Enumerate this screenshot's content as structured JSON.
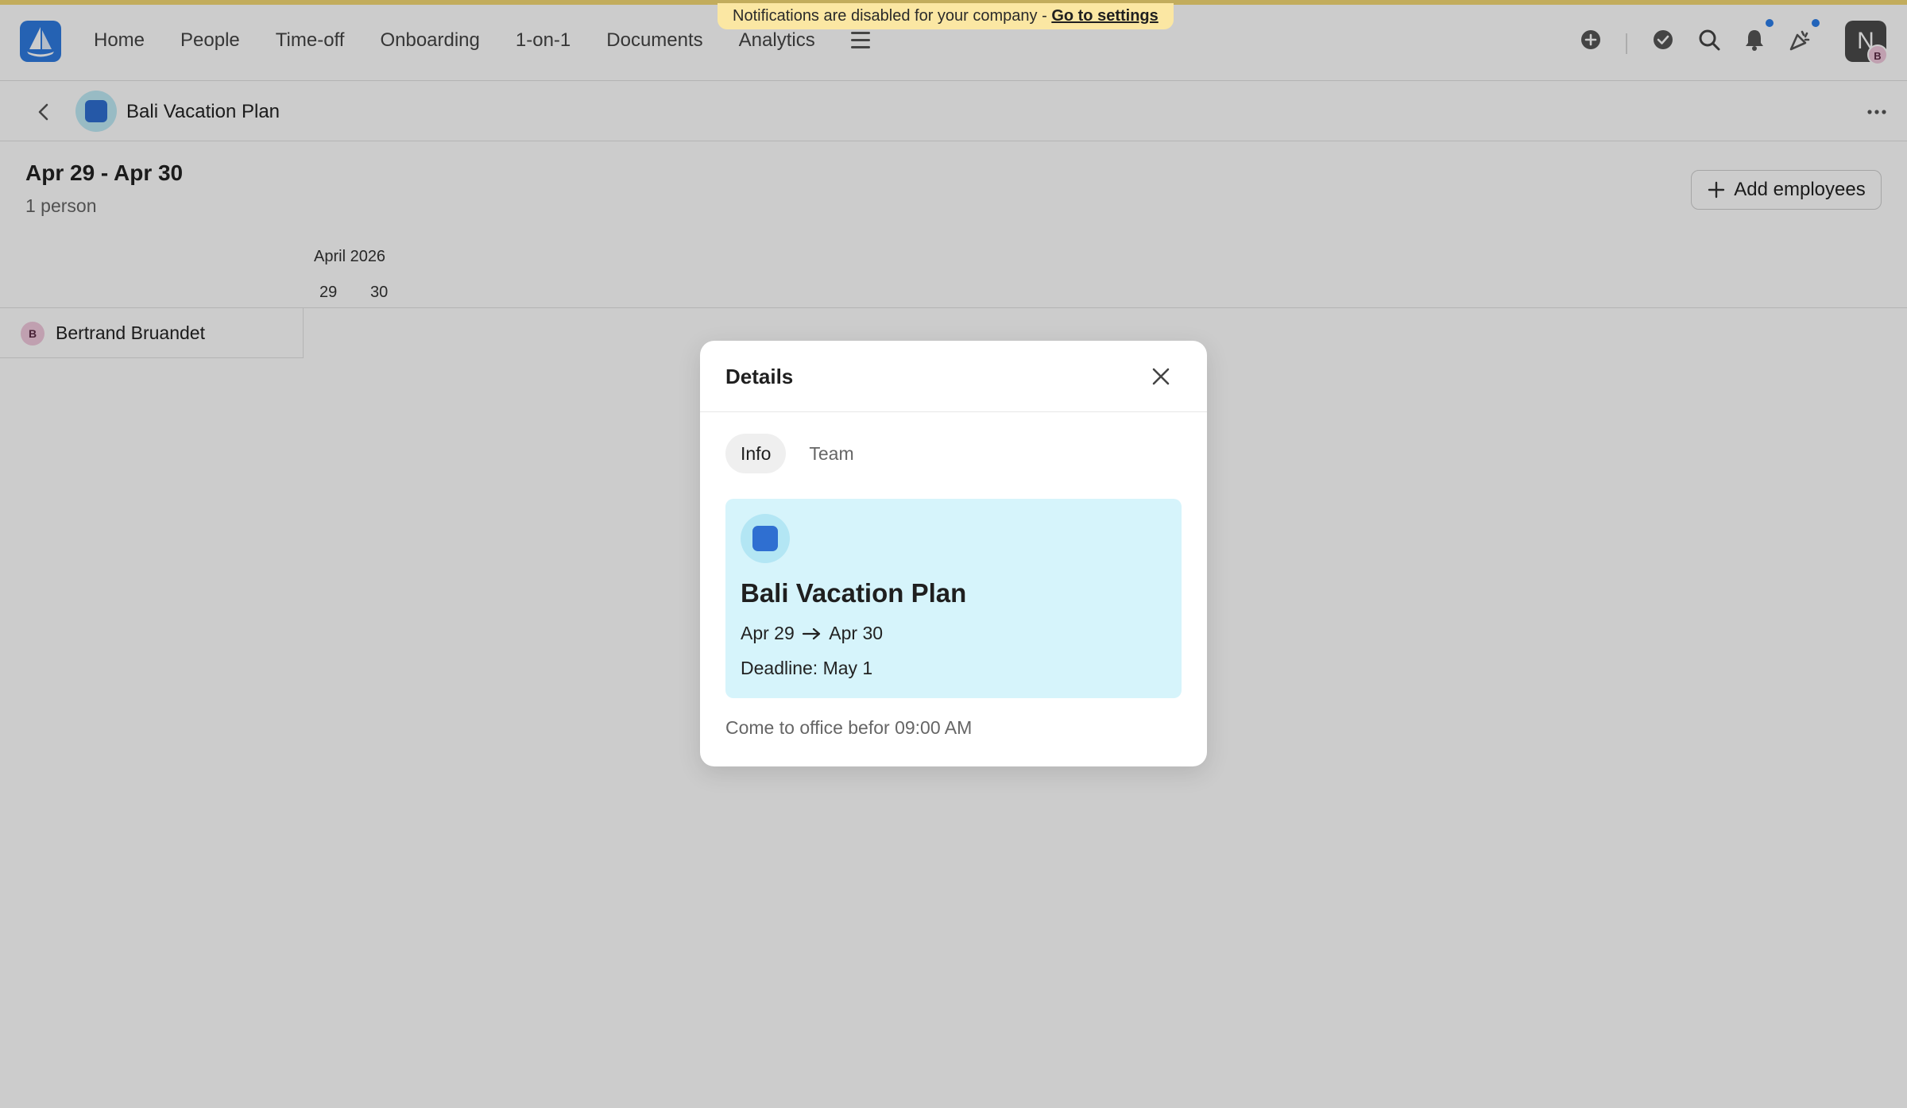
{
  "banner": {
    "text": "Notifications are disabled for your company - ",
    "link": "Go to settings"
  },
  "nav": {
    "items": [
      "Home",
      "People",
      "Time-off",
      "Onboarding",
      "1-on-1",
      "Documents",
      "Analytics"
    ]
  },
  "user": {
    "initial": "N",
    "mini_initial": "B"
  },
  "subbar": {
    "title": "Bali Vacation Plan"
  },
  "header": {
    "range": "Apr 29 - Apr 30",
    "count": "1 person",
    "add_label": "Add employees"
  },
  "calendar": {
    "month": "April 2026",
    "days": [
      "29",
      "30"
    ]
  },
  "employees": [
    {
      "initial": "B",
      "name": "Bertrand Bruandet"
    }
  ],
  "modal": {
    "title": "Details",
    "tabs": [
      "Info",
      "Team"
    ],
    "card": {
      "title": "Bali Vacation Plan",
      "start": "Apr 29",
      "end": "Apr 30",
      "deadline": "Deadline: May 1"
    },
    "description": "Come to office befor 09:00 AM"
  },
  "colors": {
    "accent": "#2f7be0",
    "card_bg": "#d6f4fb",
    "badge_dot": "#2b7de9"
  }
}
